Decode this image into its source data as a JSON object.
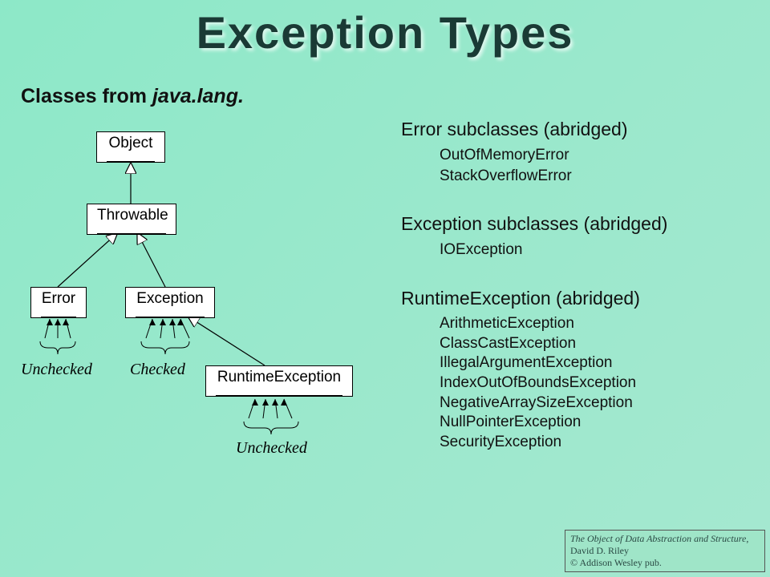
{
  "title": "Exception Types",
  "subtitle_prefix": "Classes from ",
  "subtitle_em": "java.lang.",
  "boxes": {
    "object": "Object",
    "throwable": "Throwable",
    "error": "Error",
    "exception": "Exception",
    "runtime": "RuntimeException"
  },
  "labels": {
    "unchecked1": "Unchecked",
    "checked": "Checked",
    "unchecked2": "Unchecked"
  },
  "sections": {
    "error": {
      "heading": "Error subclasses (abridged)",
      "items": [
        "OutOfMemoryError",
        "StackOverflowError"
      ]
    },
    "exception": {
      "heading": "Exception subclasses (abridged)",
      "items": [
        "IOException"
      ]
    },
    "runtime": {
      "heading": "RuntimeException (abridged)",
      "items": [
        "ArithmeticException",
        "ClassCastException",
        "IllegalArgumentException",
        "IndexOutOfBoundsException",
        "NegativeArraySizeException",
        "NullPointerException",
        "SecurityException"
      ]
    }
  },
  "footer": {
    "book_title": "The Object of Data Abstraction and Structure",
    "rest": ", David D. Riley",
    "copyright": "© Addison Wesley pub."
  }
}
